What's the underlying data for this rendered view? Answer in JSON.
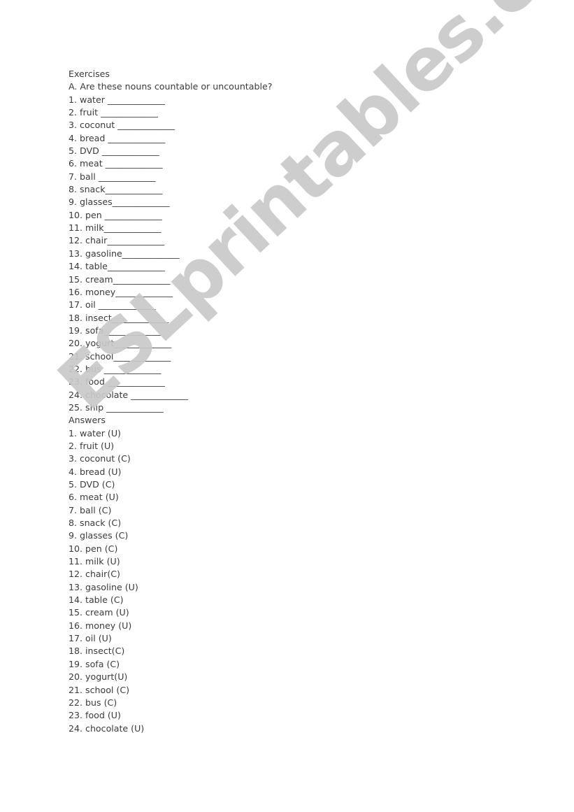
{
  "worksheet": {
    "heading": "Exercises",
    "instruction": "A. Are these nouns countable or uncountable?",
    "exercise_items": [
      {
        "text": "1. water ",
        "blank": "_____________"
      },
      {
        "text": "2. fruit ",
        "blank": "_____________"
      },
      {
        "text": "3. coconut ",
        "blank": "_____________"
      },
      {
        "text": "4. bread ",
        "blank": "_____________"
      },
      {
        "text": "5. DVD ",
        "blank": "_____________"
      },
      {
        "text": "6. meat ",
        "blank": "_____________"
      },
      {
        "text": "7. ball ",
        "blank": "_____________"
      },
      {
        "text": "8. snack",
        "blank": "_____________"
      },
      {
        "text": "9. glasses",
        "blank": "_____________"
      },
      {
        "text": "10. pen ",
        "blank": "_____________"
      },
      {
        "text": "11. milk",
        "blank": "_____________"
      },
      {
        "text": "12. chair",
        "blank": "_____________"
      },
      {
        "text": "13. gasoline",
        "blank": "_____________"
      },
      {
        "text": "14. table",
        "blank": "_____________"
      },
      {
        "text": "15. cream",
        "blank": "_____________"
      },
      {
        "text": "16. money",
        "blank": "_____________"
      },
      {
        "text": "17. oil ",
        "blank": "_____________"
      },
      {
        "text": "18. insect",
        "blank": "_____________"
      },
      {
        "text": "19. sofa",
        "blank": "_____________"
      },
      {
        "text": "20. yogurt",
        "blank": "_____________"
      },
      {
        "text": "21. school",
        "blank": "_____________"
      },
      {
        "text": "22. bus ",
        "blank": "_____________"
      },
      {
        "text": "23. food ",
        "blank": "_____________"
      },
      {
        "text": "24. chocolate ",
        "blank": "_____________"
      },
      {
        "text": "25. ship ",
        "blank": "_____________"
      }
    ],
    "answers_heading": "Answers",
    "answers": [
      "1. water (U)",
      "2. fruit (U)",
      "3. coconut (C)",
      "4. bread (U)",
      "5. DVD (C)",
      "6. meat (U)",
      "7. ball (C)",
      "8. snack (C)",
      "9. glasses (C)",
      "10. pen (C)",
      "11. milk (U)",
      "12. chair(C)",
      "13. gasoline (U)",
      "14. table (C)",
      "15. cream (U)",
      "16. money (U)",
      "17. oil (U)",
      "18. insect(C)",
      "19. sofa (C)",
      "20. yogurt(U)",
      "21. school (C)",
      "22. bus (C)",
      "23. food (U)",
      "24. chocolate (U)"
    ]
  },
  "watermark": {
    "text": "ESLprintables.com",
    "color": "#c9c9c9"
  }
}
